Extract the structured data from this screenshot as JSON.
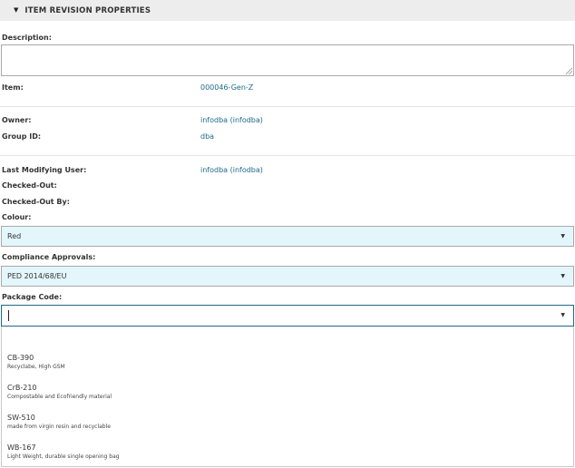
{
  "section": {
    "title": "ITEM REVISION PROPERTIES"
  },
  "fields": {
    "description_label": "Description:",
    "item_label": "Item:",
    "item_value": "000046-Gen-Z",
    "owner_label": "Owner:",
    "owner_value": "infodba (infodba)",
    "group_label": "Group ID:",
    "group_value": "dba",
    "last_modifying_label": "Last Modifying User:",
    "last_modifying_value": "infodba (infodba)",
    "checked_out_label": "Checked-Out:",
    "checked_out_by_label": "Checked-Out By:",
    "colour_label": "Colour:",
    "colour_value": "Red",
    "compliance_label": "Compliance Approvals:",
    "compliance_value": "PED 2014/68/EU",
    "package_label": "Package Code:"
  },
  "package_options": [
    {
      "code": "CB-390",
      "desc": "Recyclabe, High GSM"
    },
    {
      "code": "CrB-210",
      "desc": "Compostable and Ecofriendly material"
    },
    {
      "code": "SW-510",
      "desc": "made from virgin resin and recyclable"
    },
    {
      "code": "WB-167",
      "desc": "Light Weight, durable single opening bag"
    }
  ],
  "colors": {
    "header_bg": "#ededed",
    "select_bg": "#e3f6fb",
    "link": "#1f6a89"
  },
  "icons": {
    "collapse": "caret-down-icon",
    "dropdown": "chevron-down-icon",
    "resize": "resize-grip-icon"
  }
}
